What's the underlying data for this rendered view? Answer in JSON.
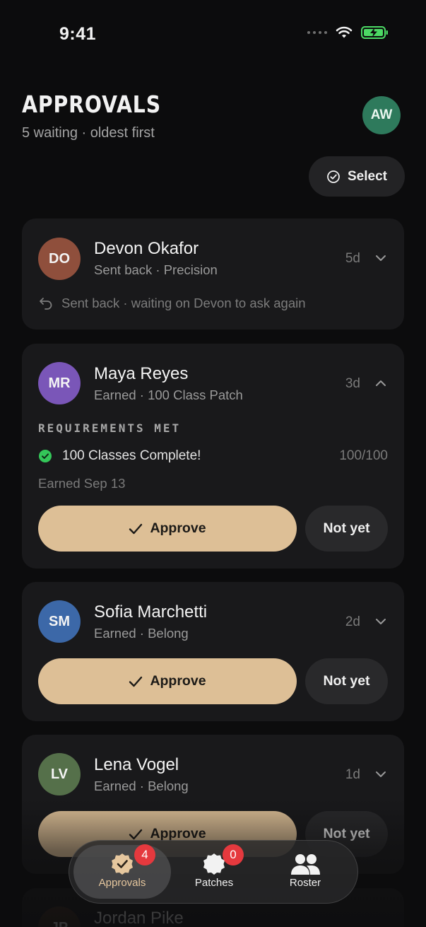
{
  "status_bar": {
    "time": "9:41"
  },
  "header": {
    "title": "APPROVALS",
    "subtitle": "5 waiting · oldest first",
    "avatar_initials": "AW",
    "select_label": "Select"
  },
  "cards": [
    {
      "initials": "DO",
      "name": "Devon Okafor",
      "meta": "Sent back · Precision",
      "age": "5d",
      "note": "Sent back · waiting on Devon to ask again",
      "avatar_color": "#8f4f3c"
    },
    {
      "initials": "MR",
      "name": "Maya Reyes",
      "meta": "Earned · 100 Class Patch",
      "age": "3d",
      "requirements_title": "REQUIREMENTS MET",
      "requirement": "100 Classes Complete!",
      "requirement_progress": "100/100",
      "earned_date": "Earned Sep 13",
      "approve_label": "Approve",
      "notyet_label": "Not yet",
      "avatar_color": "#7a56b8"
    },
    {
      "initials": "SM",
      "name": "Sofia Marchetti",
      "meta": "Earned · Belong",
      "age": "2d",
      "approve_label": "Approve",
      "notyet_label": "Not yet",
      "avatar_color": "#3c68a8"
    },
    {
      "initials": "LV",
      "name": "Lena Vogel",
      "meta": "Earned · Belong",
      "age": "1d",
      "approve_label": "Approve",
      "notyet_label": "Not yet",
      "avatar_color": "#55704a"
    },
    {
      "initials": "JP",
      "name": "Jordan Pike"
    }
  ],
  "tabbar": {
    "tabs": [
      {
        "label": "Approvals",
        "badge": "4"
      },
      {
        "label": "Patches",
        "badge": "0"
      },
      {
        "label": "Roster"
      }
    ]
  },
  "colors": {
    "accent": "#ddbf96",
    "badge": "#e5393e",
    "success": "#34c759",
    "battery": "#4cd964"
  }
}
